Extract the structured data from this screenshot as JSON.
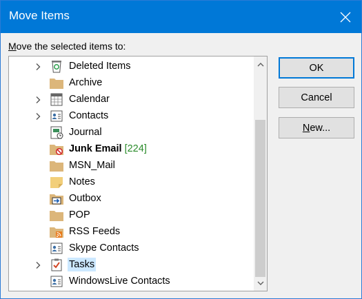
{
  "window": {
    "title": "Move Items"
  },
  "prompt": {
    "mnemonic": "M",
    "rest": "ove the selected items to:"
  },
  "folders": [
    {
      "label": "Deleted Items",
      "icon": "recycle-bin-icon",
      "expandable": true
    },
    {
      "label": "Archive",
      "icon": "folder-icon",
      "expandable": false
    },
    {
      "label": "Calendar",
      "icon": "calendar-icon",
      "expandable": true
    },
    {
      "label": "Contacts",
      "icon": "contacts-icon",
      "expandable": true
    },
    {
      "label": "Journal",
      "icon": "journal-icon",
      "expandable": false
    },
    {
      "label": "Junk Email",
      "count": "[224]",
      "icon": "junk-folder-icon",
      "expandable": false,
      "bold": true
    },
    {
      "label": "MSN_Mail",
      "icon": "folder-icon",
      "expandable": false
    },
    {
      "label": "Notes",
      "icon": "notes-icon",
      "expandable": false
    },
    {
      "label": "Outbox",
      "icon": "outbox-icon",
      "expandable": false
    },
    {
      "label": "POP",
      "icon": "folder-icon",
      "expandable": false
    },
    {
      "label": "RSS Feeds",
      "icon": "rss-folder-icon",
      "expandable": false
    },
    {
      "label": "Skype Contacts",
      "icon": "contacts-icon",
      "expandable": false
    },
    {
      "label": "Tasks",
      "icon": "tasks-icon",
      "expandable": true,
      "selected": true
    },
    {
      "label": "WindowsLive Contacts",
      "icon": "contacts-icon",
      "expandable": false
    }
  ],
  "buttons": {
    "ok": "OK",
    "cancel": "Cancel",
    "new_mnemonic": "N",
    "new_rest": "ew..."
  },
  "colors": {
    "titlebar": "#0078d7",
    "selection": "#cce8ff",
    "count": "#2a8b2a",
    "folder": "#dcb67a"
  }
}
